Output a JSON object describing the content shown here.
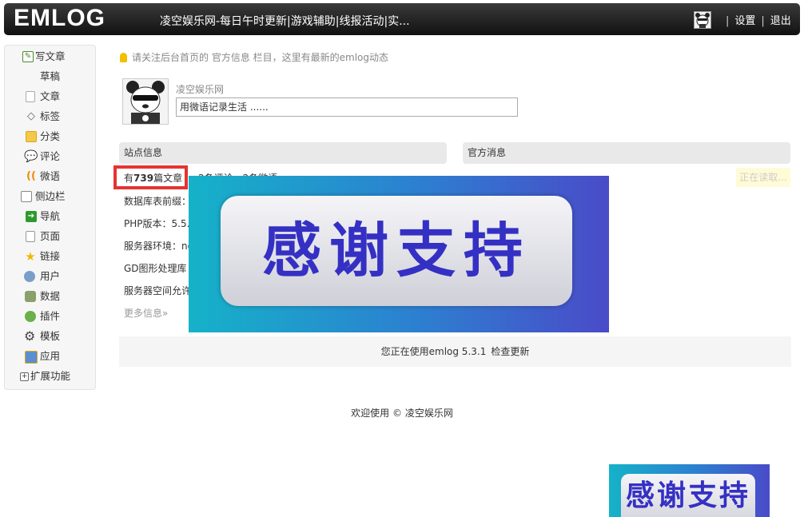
{
  "header": {
    "logo": "EMLOG",
    "site_title": "凌空娱乐网-每日午时更新|游戏辅助|线报活动|实...",
    "links": {
      "settings": "设置",
      "logout": "退出"
    }
  },
  "sidebar": {
    "items": [
      {
        "label": "写文章",
        "icon": "edit-icon"
      },
      {
        "label": "草稿",
        "icon": ""
      },
      {
        "label": "文章",
        "icon": "document-icon"
      },
      {
        "label": "标签",
        "icon": "tag-icon"
      },
      {
        "label": "分类",
        "icon": "grid-icon"
      },
      {
        "label": "评论",
        "icon": "comment-icon"
      },
      {
        "label": "微语",
        "icon": "wave-icon"
      },
      {
        "label": "侧边栏",
        "icon": "sidebar-icon"
      },
      {
        "label": "导航",
        "icon": "arrow-right-icon"
      },
      {
        "label": "页面",
        "icon": "page-icon"
      },
      {
        "label": "链接",
        "icon": "star-icon"
      },
      {
        "label": "用户",
        "icon": "users-icon"
      },
      {
        "label": "数据",
        "icon": "database-icon"
      },
      {
        "label": "插件",
        "icon": "plugin-icon"
      },
      {
        "label": "模板",
        "icon": "gear-icon"
      },
      {
        "label": "应用",
        "icon": "app-icon"
      },
      {
        "label": "扩展功能",
        "icon": "plus-box-icon"
      }
    ]
  },
  "tip": "请关注后台首页的 官方信息 栏目，这里有最新的emlog动态",
  "twitter": {
    "user_name": "凌空娱乐网",
    "placeholder": "用微语记录生活 ......"
  },
  "site_info": {
    "heading": "站点信息",
    "count_prefix": "有",
    "article_count": "739",
    "count_suffix": "篇文章",
    "behind_text": "，2条评论，2条微语",
    "lines": [
      "数据库表前缀：",
      "PHP版本：5.5.",
      "服务器环境：ng",
      "GD图形处理库",
      "服务器空间允许"
    ],
    "more": "更多信息»"
  },
  "official": {
    "heading": "官方消息",
    "reading": "正在读取..."
  },
  "banner": {
    "text": "感谢支持"
  },
  "version": {
    "text": "您正在使用emlog 5.3.1",
    "check": "检查更新"
  },
  "footer": {
    "prefix": "欢迎使用 ©",
    "site": "凌空娱乐网"
  },
  "colors": {
    "header_bg": "#1a1a1a",
    "highlight_border": "#e53333",
    "banner_text": "#3530c4"
  }
}
